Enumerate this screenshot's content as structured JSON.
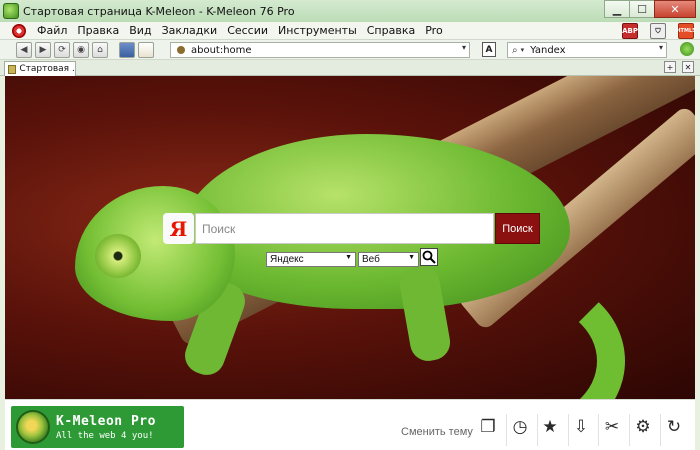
{
  "window": {
    "title": "Стартовая страница K-Meleon - K-Meleon 76 Pro",
    "minimize_glyph": "▁",
    "maximize_glyph": "☐",
    "close_glyph": "✕"
  },
  "menu": {
    "items": [
      "Файл",
      "Правка",
      "Вид",
      "Закладки",
      "Сессии",
      "Инструменты",
      "Справка",
      "Pro"
    ],
    "right_buttons": [
      "ABP",
      "⛉",
      "HTML5"
    ]
  },
  "navigation": {
    "back_glyph": "◀",
    "forward_glyph": "▶",
    "reload_glyph": "⟳",
    "stop_glyph": "◉",
    "home_glyph": "⌂",
    "address": "about:home",
    "reader_glyph": "A",
    "search_engine": "Yandex",
    "dropdown_glyph": "▾"
  },
  "tabs": [
    {
      "label": "Стартовая ...",
      "active": true
    }
  ],
  "search": {
    "logo_letter": "Я",
    "placeholder": "Поиск",
    "submit_label": "Поиск",
    "engine_select": "Яндекс",
    "type_select": "Веб",
    "go_glyph": "🔍"
  },
  "bottom": {
    "brand_name": "K-Meleon Pro",
    "brand_tagline": "All the web 4 you!",
    "change_theme": "Сменить тему",
    "icons": [
      "copy-icon",
      "history-icon",
      "bookmarks-icon",
      "download-icon",
      "tools-icon",
      "settings-icon",
      "reset-icon"
    ],
    "icon_glyphs": [
      "❐",
      "◷",
      "★",
      "⇩",
      "✂",
      "⚙",
      "↻"
    ]
  },
  "colors": {
    "titlebar": "#bcdcb6",
    "search_button": "#8b1010",
    "brand_background": "#2e9a36",
    "yandex_red": "#e61400"
  }
}
